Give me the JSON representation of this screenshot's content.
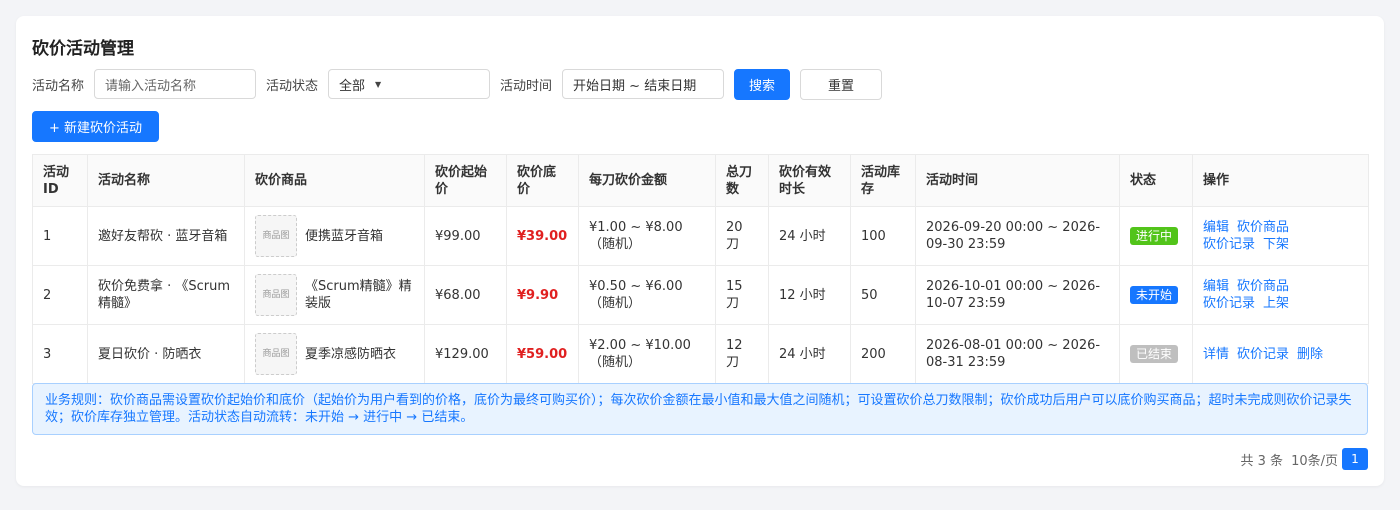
{
  "page": {
    "title": "砍价活动管理"
  },
  "filters": {
    "name_label": "活动名称",
    "name_placeholder": "请输入活动名称",
    "status_label": "活动状态",
    "status_value": "全部",
    "time_label": "活动时间",
    "time_value": "开始日期 ~ 结束日期",
    "search_label": "搜索",
    "reset_label": "重置"
  },
  "new_button_label": "+ 新建砍价活动",
  "columns": [
    "活动ID",
    "活动名称",
    "砍价商品",
    "砍价起始价",
    "砍价底价",
    "每刀砍价金额",
    "总刀数",
    "砍价有效时长",
    "活动库存",
    "活动时间",
    "状态",
    "操作"
  ],
  "thumb_label": "商品图",
  "rows": [
    {
      "id": "1",
      "name": "邀好友帮砍 · 蓝牙音箱",
      "goods": "便携蓝牙音箱",
      "start_price": "¥99.00",
      "floor_price": "¥39.00",
      "per_cut": "¥1.00 ~ ¥8.00（随机）",
      "cuts": "20 刀",
      "duration": "24 小时",
      "stock": "100",
      "time": "2026-09-20 00:00 ~ 2026-09-30 23:59",
      "status": "进行中",
      "status_color": "#52c41a",
      "actions": [
        "编辑",
        "砍价商品",
        "砍价记录",
        "下架"
      ]
    },
    {
      "id": "2",
      "name": "砍价免费拿 · 《Scrum精髓》",
      "goods": "《Scrum精髓》精装版",
      "start_price": "¥68.00",
      "floor_price": "¥9.90",
      "per_cut": "¥0.50 ~ ¥6.00（随机）",
      "cuts": "15 刀",
      "duration": "12 小时",
      "stock": "50",
      "time": "2026-10-01 00:00 ~ 2026-10-07 23:59",
      "status": "未开始",
      "status_color": "#1677ff",
      "actions": [
        "编辑",
        "砍价商品",
        "砍价记录",
        "上架"
      ]
    },
    {
      "id": "3",
      "name": "夏日砍价 · 防晒衣",
      "goods": "夏季凉感防晒衣",
      "start_price": "¥129.00",
      "floor_price": "¥59.00",
      "per_cut": "¥2.00 ~ ¥10.00（随机）",
      "cuts": "12 刀",
      "duration": "24 小时",
      "stock": "200",
      "time": "2026-08-01 00:00 ~ 2026-08-31 23:59",
      "status": "已结束",
      "status_color": "#bfbfbf",
      "actions": [
        "详情",
        "砍价记录",
        "删除"
      ]
    }
  ],
  "notice": "业务规则：砍价商品需设置砍价起始价和底价（起始价为用户看到的价格，底价为最终可购买价）；每次砍价金额在最小值和最大值之间随机；可设置砍价总刀数限制；砍价成功后用户可以底价购买商品；超时未完成则砍价记录失效；砍价库存独立管理。活动状态自动流转：未开始 → 进行中 → 已结束。",
  "pager": {
    "total": "共 3 条",
    "page_size": "10条/页",
    "current": "1"
  }
}
